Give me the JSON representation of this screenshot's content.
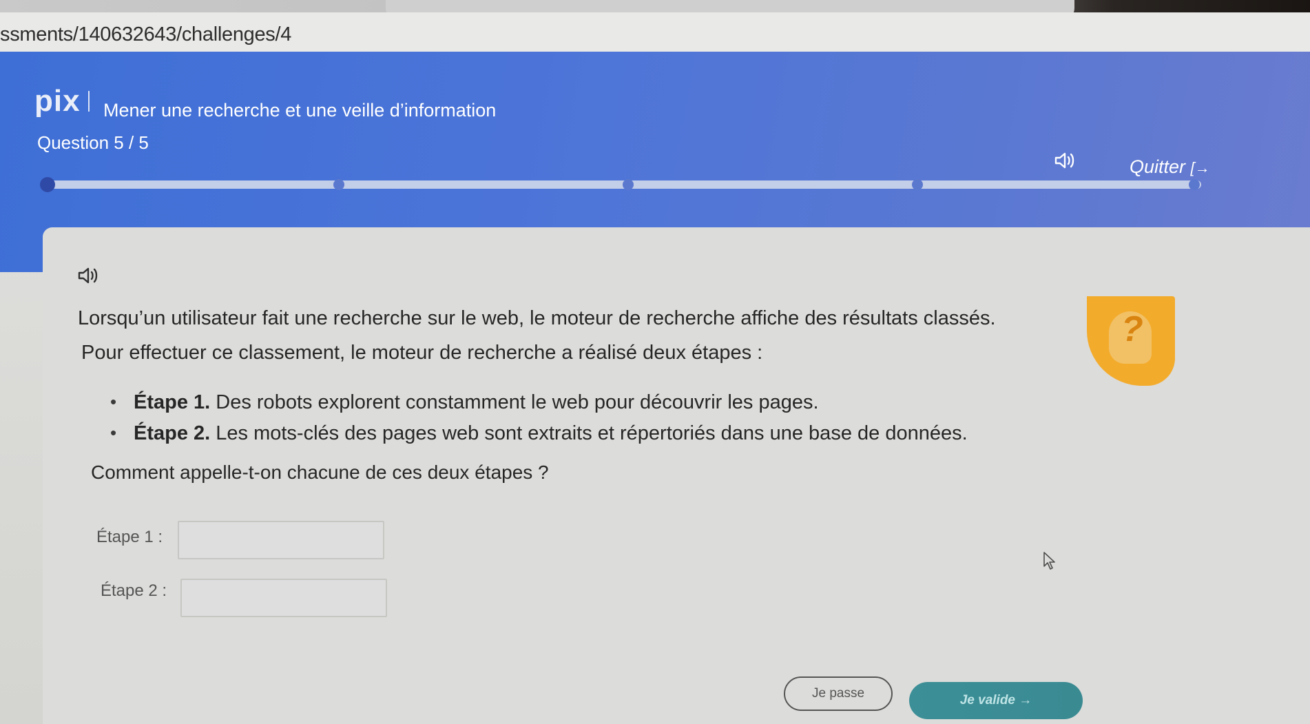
{
  "browser": {
    "url": "ssments/140632643/challenges/4",
    "read_aloud_icon": "A⁾",
    "favorite_icon": "star-outline"
  },
  "header": {
    "brand": "pix",
    "title": "Mener une recherche et une veille d’information",
    "question_counter": "Question 5 / 5",
    "quit_label": "Quitter",
    "quit_icon": "[→",
    "progress": {
      "current": 5,
      "total": 5
    }
  },
  "challenge": {
    "intro_1": "Lorsqu’un utilisateur fait une recherche sur le web, le moteur de recherche affiche des résultats classés.",
    "intro_2": "Pour effectuer ce classement, le moteur de recherche a réalisé deux étapes :",
    "steps": [
      {
        "label": "Étape 1.",
        "text": " Des robots explorent constamment le web pour découvrir les pages."
      },
      {
        "label": "Étape 2.",
        "text": " Les mots-clés des pages web sont extraits et répertoriés dans une base de données."
      }
    ],
    "question": "Comment appelle-t-on chacune de ces deux étapes ?",
    "fields": [
      {
        "label": "Étape 1 :",
        "value": "",
        "placeholder": ""
      },
      {
        "label": "Étape 2 :",
        "value": "",
        "placeholder": ""
      }
    ]
  },
  "actions": {
    "skip_label": "Je passe",
    "validate_label": "Je valide  →"
  },
  "help": {
    "glyph": "?"
  },
  "colors": {
    "header_blue": "#4e75d8",
    "help_orange": "#f3ab2c",
    "validate_teal": "#3c8f97"
  }
}
